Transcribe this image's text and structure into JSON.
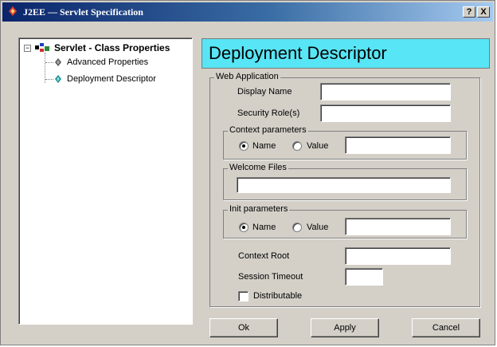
{
  "window": {
    "title": "J2EE — Servlet Specification",
    "help_button": "?",
    "close_button": "X"
  },
  "tree": {
    "root_toggle": "−",
    "root": "Servlet - Class Properties",
    "children": [
      "Advanced Properties",
      "Deployment Descriptor"
    ]
  },
  "header": {
    "title": "Deployment Descriptor",
    "color": "#58e5f5"
  },
  "web_application": {
    "legend": "Web Application",
    "display_name_label": "Display Name",
    "display_name_value": "",
    "security_roles_label": "Security Role(s)",
    "security_roles_value": "",
    "context_parameters": {
      "legend": "Context parameters",
      "name_option": "Name",
      "value_option": "Value",
      "selected": "Name",
      "text_value": ""
    },
    "welcome_files": {
      "legend": "Welcome Files",
      "value": ""
    },
    "init_parameters": {
      "legend": "Init parameters",
      "name_option": "Name",
      "value_option": "Value",
      "selected": "Name",
      "text_value": ""
    },
    "context_root_label": "Context Root",
    "context_root_value": "",
    "session_timeout_label": "Session Timeout",
    "session_timeout_value": "",
    "distributable_label": "Distributable",
    "distributable_checked": false
  },
  "buttons": {
    "ok": "Ok",
    "apply": "Apply",
    "cancel": "Cancel"
  }
}
